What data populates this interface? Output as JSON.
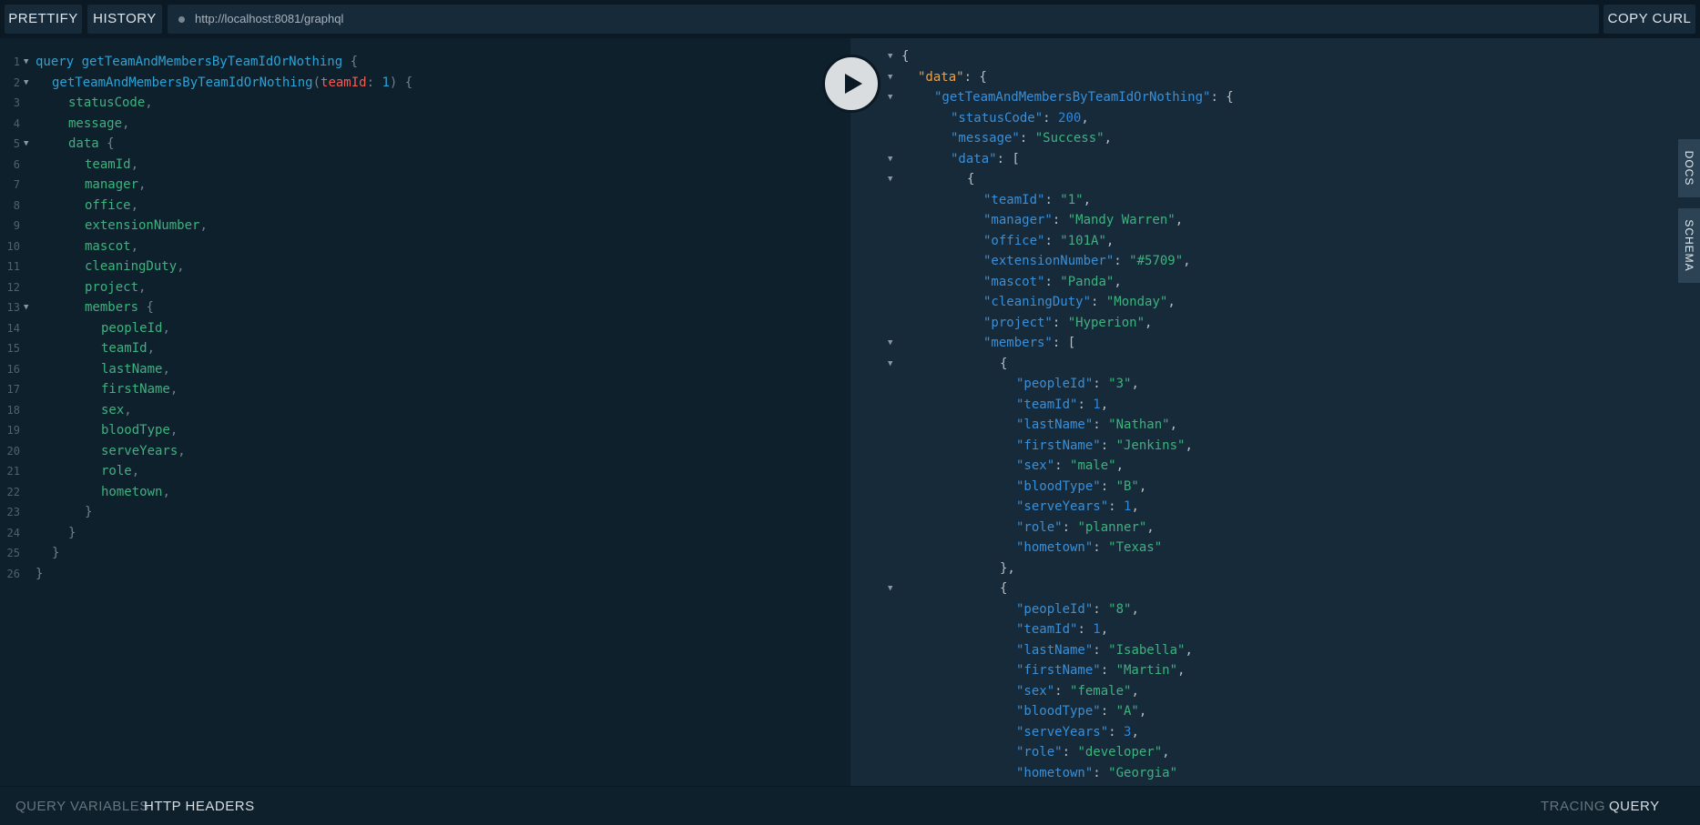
{
  "toolbar": {
    "prettify_label": "PRETTIFY",
    "history_label": "HISTORY",
    "url": "http://localhost:8081/graphql",
    "copy_curl_label": "COPY CURL"
  },
  "side_tabs": {
    "docs_label": "DOCS",
    "schema_label": "SCHEMA"
  },
  "bottom_bar": {
    "query_variables_label": "QUERY VARIABLES",
    "http_headers_label": "HTTP HEADERS",
    "tracing_label": "TRACING",
    "query_plan_label": "QUERY PLAN"
  },
  "query": {
    "operation_keyword": "query",
    "operation_name": "getTeamAndMembersByTeamIdOrNothing",
    "root_field": "getTeamAndMembersByTeamIdOrNothing",
    "arg_name": "teamId",
    "arg_value": "1",
    "fields": [
      "statusCode",
      "message"
    ],
    "data_field": "data",
    "data_fields": [
      "teamId",
      "manager",
      "office",
      "extensionNumber",
      "mascot",
      "cleaningDuty",
      "project"
    ],
    "members_field": "members",
    "member_fields": [
      "peopleId",
      "teamId",
      "lastName",
      "firstName",
      "sex",
      "bloodType",
      "serveYears",
      "role",
      "hometown"
    ],
    "line_numbers": [
      "1",
      "2",
      "3",
      "4",
      "5",
      "6",
      "7",
      "8",
      "9",
      "10",
      "11",
      "12",
      "13",
      "14",
      "15",
      "16",
      "17",
      "18",
      "19",
      "20",
      "21",
      "22",
      "23",
      "24",
      "25",
      "26"
    ]
  },
  "result": {
    "data_key": "data",
    "root_key": "getTeamAndMembersByTeamIdOrNothing",
    "statusCode": "200",
    "message": "Success",
    "team": [
      {
        "k": "teamId",
        "v": "\"1\"",
        "t": "str"
      },
      {
        "k": "manager",
        "v": "\"Mandy Warren\"",
        "t": "str"
      },
      {
        "k": "office",
        "v": "\"101A\"",
        "t": "str"
      },
      {
        "k": "extensionNumber",
        "v": "\"#5709\"",
        "t": "str"
      },
      {
        "k": "mascot",
        "v": "\"Panda\"",
        "t": "str"
      },
      {
        "k": "cleaningDuty",
        "v": "\"Monday\"",
        "t": "str"
      },
      {
        "k": "project",
        "v": "\"Hyperion\"",
        "t": "str"
      }
    ],
    "members": [
      [
        {
          "k": "peopleId",
          "v": "\"3\"",
          "t": "str"
        },
        {
          "k": "teamId",
          "v": "1",
          "t": "num"
        },
        {
          "k": "lastName",
          "v": "\"Nathan\"",
          "t": "str"
        },
        {
          "k": "firstName",
          "v": "\"Jenkins\"",
          "t": "str"
        },
        {
          "k": "sex",
          "v": "\"male\"",
          "t": "str"
        },
        {
          "k": "bloodType",
          "v": "\"B\"",
          "t": "str"
        },
        {
          "k": "serveYears",
          "v": "1",
          "t": "num"
        },
        {
          "k": "role",
          "v": "\"planner\"",
          "t": "str"
        },
        {
          "k": "hometown",
          "v": "\"Texas\"",
          "t": "str"
        }
      ],
      [
        {
          "k": "peopleId",
          "v": "\"8\"",
          "t": "str"
        },
        {
          "k": "teamId",
          "v": "1",
          "t": "num"
        },
        {
          "k": "lastName",
          "v": "\"Isabella\"",
          "t": "str"
        },
        {
          "k": "firstName",
          "v": "\"Martin\"",
          "t": "str"
        },
        {
          "k": "sex",
          "v": "\"female\"",
          "t": "str"
        },
        {
          "k": "bloodType",
          "v": "\"A\"",
          "t": "str"
        },
        {
          "k": "serveYears",
          "v": "3",
          "t": "num"
        },
        {
          "k": "role",
          "v": "\"developer\"",
          "t": "str"
        },
        {
          "k": "hometown",
          "v": "\"Georgia\"",
          "t": "str"
        }
      ]
    ]
  },
  "icons": {
    "run": "play-icon",
    "url_status": "status-dot-icon",
    "fold": "fold-arrow-icon"
  }
}
